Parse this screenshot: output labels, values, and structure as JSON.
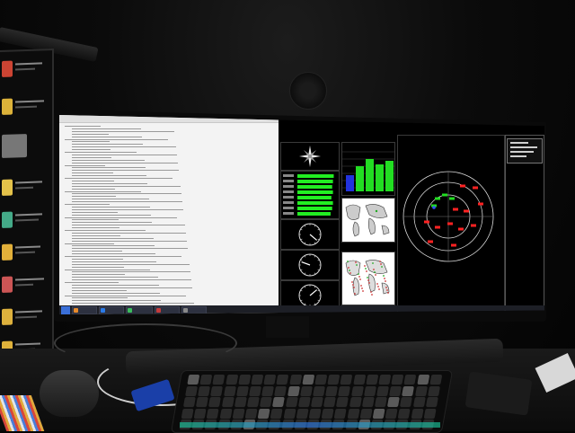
{
  "scene": {
    "description_free": true
  },
  "colors": {
    "terminal_bg": "#f3f3f3",
    "panel_bg": "#000000",
    "bar_blue": "#2233dd",
    "bar_green": "#22dd22",
    "signal_green": "#22ee22",
    "target_green": "#22dd22",
    "target_red": "#ff2222",
    "radar_ring": "#dddddd",
    "taskbar": "#1d1f26",
    "keyboard_glow": "#1bd3a3"
  },
  "icons": {
    "compass": "compass-rose-icon",
    "start": "windows-start-icon",
    "webcam": "webcam-icon"
  },
  "bar_chart": {
    "values": [
      0.45,
      0.7,
      0.9,
      0.75,
      0.85
    ],
    "colors": [
      "#2233dd",
      "#22dd22",
      "#22dd22",
      "#22dd22",
      "#22dd22"
    ]
  },
  "signal_bars": {
    "count": 8,
    "levels": [
      0.92,
      0.9,
      0.88,
      0.9,
      0.86,
      0.9,
      0.88,
      0.84
    ]
  },
  "gauges": [
    {
      "needle_deg": 40
    },
    {
      "needle_deg": 200
    },
    {
      "needle_deg": 320
    }
  ],
  "radar": {
    "rings": 3,
    "targets_green": 4,
    "targets_red": 12
  }
}
